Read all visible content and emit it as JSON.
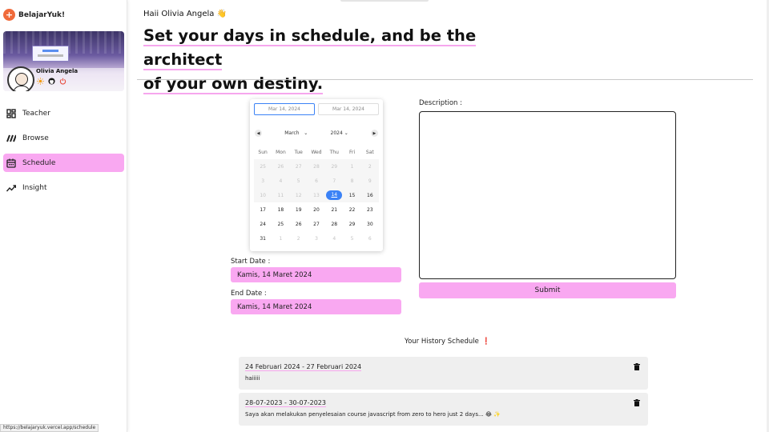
{
  "brand": {
    "name": "BelajarYuk!",
    "logo_glyph": "+"
  },
  "profile": {
    "name": "Olivia Angela",
    "icons": [
      "sun-icon",
      "github-icon",
      "power-icon"
    ]
  },
  "nav": {
    "items": [
      {
        "label": "Teacher",
        "icon": "grid-icon",
        "active": false
      },
      {
        "label": "Browse",
        "icon": "stripes-icon",
        "active": false
      },
      {
        "label": "Schedule",
        "icon": "calendar-icon",
        "active": true
      },
      {
        "label": "Insight",
        "icon": "trend-icon",
        "active": false
      }
    ]
  },
  "header": {
    "greeting": "Haii Olivia Angela 👋",
    "headline_line1": "Set your days in schedule, and be the architect",
    "headline_line2": "of your own destiny."
  },
  "picker": {
    "start_input": "Mar 14, 2024",
    "end_input": "Mar 14, 2024",
    "month": "March",
    "year": "2024",
    "prev_glyph": "◀",
    "next_glyph": "▶",
    "weekdays": [
      "Sun",
      "Mon",
      "Tue",
      "Wed",
      "Thu",
      "Fri",
      "Sat"
    ],
    "weeks": [
      [
        "25",
        "26",
        "27",
        "28",
        "29",
        "1",
        "2"
      ],
      [
        "3",
        "4",
        "5",
        "6",
        "7",
        "8",
        "9"
      ],
      [
        "10",
        "11",
        "12",
        "13",
        "14",
        "15",
        "16"
      ],
      [
        "17",
        "18",
        "19",
        "20",
        "21",
        "22",
        "23"
      ],
      [
        "24",
        "25",
        "26",
        "27",
        "28",
        "29",
        "30"
      ],
      [
        "31",
        "1",
        "2",
        "3",
        "4",
        "5",
        "6"
      ]
    ],
    "selected": "14"
  },
  "form": {
    "start_label": "Start Date :",
    "start_value": "Kamis, 14 Maret 2024",
    "end_label": "End Date :",
    "end_value": "Kamis, 14 Maret 2024",
    "description_label": "Description :",
    "description_value": "",
    "submit_label": "Submit"
  },
  "history": {
    "title": "Your History Schedule",
    "title_mark": "❗",
    "items": [
      {
        "range": "24 Februari 2024 - 27 Februari 2024",
        "note": "haiiiii"
      },
      {
        "range": "28-07-2023 - 30-07-2023",
        "note": "Saya akan melakukan penyelesaian course javascript from zero to hero just 2 days... 😂 ✨"
      }
    ]
  },
  "status_url": "https://belajaryuk.vercel.app/schedule",
  "colors": {
    "accent_pink": "#f9a8f1",
    "underline_pink": "#f6a6ee",
    "brand_orange": "#f06a3a",
    "selected_blue": "#3b82f6"
  }
}
